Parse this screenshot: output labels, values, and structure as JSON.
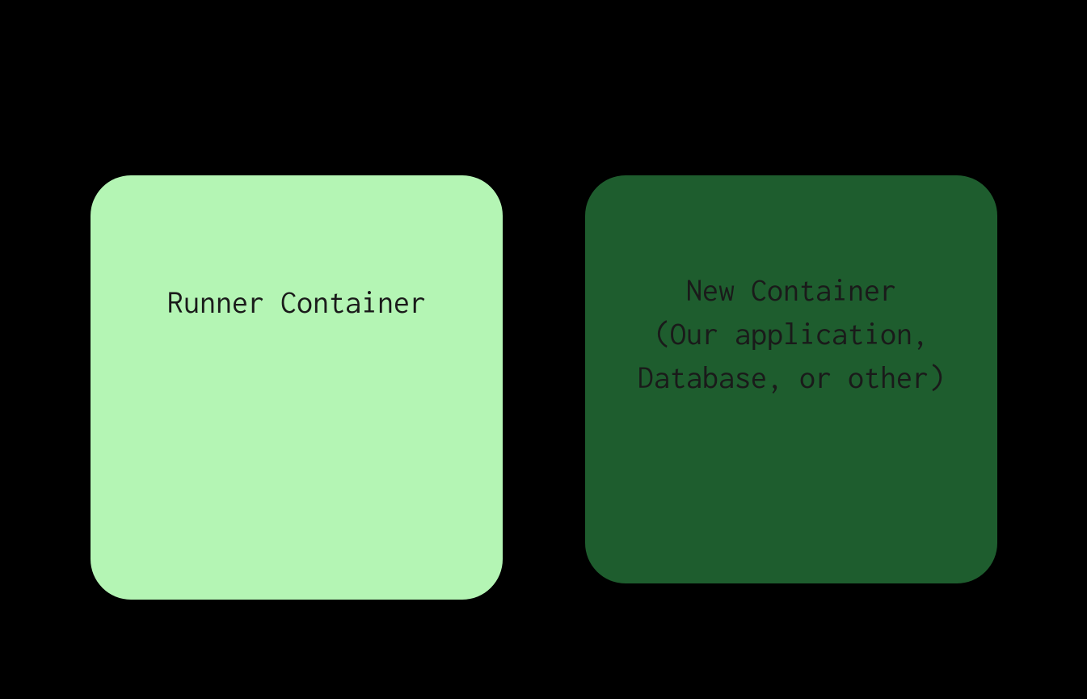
{
  "boxes": {
    "runner": {
      "label": "Runner Container"
    },
    "new": {
      "label": "New Container\n(Our application,\nDatabase, or other)"
    }
  }
}
